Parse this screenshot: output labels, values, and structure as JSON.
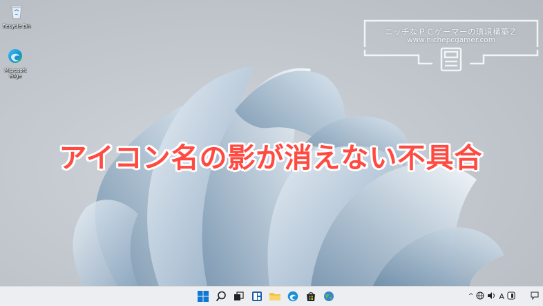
{
  "desktop": {
    "icons": [
      {
        "label": "Recycle Bin",
        "icon": "recycle-bin-icon"
      },
      {
        "label": "Microsoft Edge",
        "icon": "edge-icon"
      }
    ]
  },
  "overlay": {
    "watermark_title": "ニッチなＰＣゲーマーの環境構築Ｚ",
    "watermark_url": "www.nichepcgamer.com",
    "headline": "アイコン名の影が消えない不具合"
  },
  "taskbar": {
    "apps": [
      {
        "name": "start",
        "icon": "windows-start-icon"
      },
      {
        "name": "search",
        "icon": "search-icon"
      },
      {
        "name": "task-view",
        "icon": "task-view-icon"
      },
      {
        "name": "widgets",
        "icon": "widgets-icon"
      },
      {
        "name": "file-explorer",
        "icon": "folder-icon"
      },
      {
        "name": "edge",
        "icon": "edge-icon"
      },
      {
        "name": "store",
        "icon": "store-icon"
      },
      {
        "name": "globe-app",
        "icon": "globe-icon"
      }
    ],
    "tray": {
      "chevron": "^",
      "ime": "A",
      "icons": [
        "network-icon",
        "speaker-icon",
        "battery-icon",
        "notification-icon"
      ]
    }
  },
  "colors": {
    "headline": "#ff4a42",
    "taskbar": "#eceef1",
    "accent": "#0078d4"
  }
}
